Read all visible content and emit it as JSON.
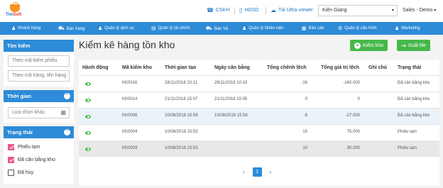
{
  "logo": {
    "brand1": "Tim",
    "brand2": "Soft"
  },
  "top": {
    "cskh": "CSKH",
    "hdsd": "HDSD",
    "ultra": "Tải Ultra viewer",
    "branch": "Kiên Giang",
    "user": "Sales - Demo"
  },
  "nav": [
    "Khách hàng",
    "Bán hàng",
    "Quản lý dịch vụ",
    "Quản lý tài chính",
    "Bán Vé",
    "Quản lý Nhân viên",
    "Báo cáo",
    "Quản lý cấu hình",
    "Marketing"
  ],
  "sidebar": {
    "search_title": "Tìm kiếm",
    "search_code_placeholder": "Theo mã kiểm phiếu",
    "search_item_placeholder": "Theo mã hàng, tên hàng",
    "time_title": "Thời gian",
    "time_value": "Lựa chọn khác",
    "status_title": "Trạng thái",
    "status_options": [
      {
        "label": "Phiếu tạm",
        "checked": true
      },
      {
        "label": "Đã cân bằng kho",
        "checked": true
      },
      {
        "label": "Đã hủy",
        "checked": false
      }
    ]
  },
  "main": {
    "title": "Kiểm kê hàng tồn kho",
    "btn_check": "Kiểm kho",
    "btn_export": "Xuất file",
    "columns": [
      "Hành động",
      "Mã kiểm kho",
      "Thời gian tạo",
      "Ngày cân bằng",
      "Tổng chênh lệch",
      "Tổng giá trị lệch",
      "Ghi chú",
      "Trạng thái"
    ],
    "rows": [
      {
        "code": "KK0016",
        "created": "28/11/2018 10:11",
        "balanced": "28/11/2018 10:10",
        "diff": "-16",
        "value": "-160.000",
        "note": "",
        "status": "Đã cân bằng kho"
      },
      {
        "code": "KK0014",
        "created": "21/11/2018 15:07",
        "balanced": "21/11/2018 15:05",
        "diff": "0",
        "value": "0",
        "note": "",
        "status": "Đã cân bằng kho"
      },
      {
        "code": "KK0006",
        "created": "10/08/2018 15:58",
        "balanced": "10/08/2018 15:58",
        "diff": "-9",
        "value": "-27.000",
        "note": "",
        "status": "Đã cân bằng kho"
      },
      {
        "code": "KK0004",
        "created": "10/08/2018 15:53",
        "balanced": "",
        "diff": "15",
        "value": "75.000",
        "note": "",
        "status": "Phiếu tạm"
      },
      {
        "code": "KK0003",
        "created": "10/08/2018 15:53",
        "balanced": "",
        "diff": "10",
        "value": "30.000",
        "note": "",
        "status": "Phiếu tạm"
      }
    ],
    "pager": {
      "prev": "‹",
      "current": "1",
      "next": "›"
    }
  }
}
